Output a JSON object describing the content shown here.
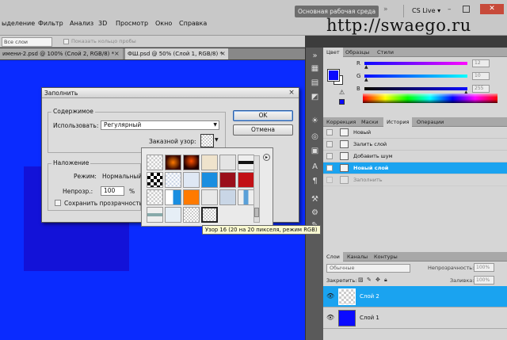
{
  "menubar": {
    "items": [
      "ыделение",
      "Фильтр",
      "Анализ",
      "3D",
      "Просмотр",
      "Окно",
      "Справка"
    ],
    "workspace_button": "Основная рабочая среда",
    "workspace_arrow": "»",
    "cslive": "CS Live ▾"
  },
  "watermark": "http://swaego.ru",
  "optbar": {
    "layer_select": "Все слои",
    "option_label": "Показать кольцо пробы"
  },
  "doctabs": [
    {
      "label": "имени-2.psd @ 100% (Слой 2, RGB/8) *"
    },
    {
      "label": "ФШ.psd @ 50% (Слой 1, RGB/8) *"
    }
  ],
  "tab_close": "×",
  "colors": {
    "foreground": "#0a0aff",
    "canvas": "#0a2bff",
    "layer_square": "#1312d8",
    "selection": "#1aa3f0"
  },
  "color_panel": {
    "tabs": [
      "Цвет",
      "Образцы",
      "Стили"
    ],
    "channels": [
      {
        "name": "R",
        "value": "12"
      },
      {
        "name": "G",
        "value": "10"
      },
      {
        "name": "B",
        "value": "255"
      }
    ]
  },
  "history_panel": {
    "tabs": [
      "Коррекция",
      "Маски",
      "История",
      "Операции"
    ],
    "items": [
      {
        "label": "Новый"
      },
      {
        "label": "Залить слой"
      },
      {
        "label": "Добавить шум"
      },
      {
        "label": "Новый слой"
      },
      {
        "label": "Заполнить"
      }
    ]
  },
  "layers_panel": {
    "tabs": [
      "Слои",
      "Каналы",
      "Контуры"
    ],
    "blend_mode": "Обычные",
    "opacity_label": "Непрозрачность:",
    "opacity_value": "100%",
    "lock_label": "Закрепить:",
    "fill_label": "Заливка:",
    "fill_value": "100%",
    "layers": [
      {
        "name": "Слой 2"
      },
      {
        "name": "Слой 1"
      }
    ]
  },
  "dialog": {
    "title": "Заполнить",
    "close": "×",
    "contents_legend": "Содержимое",
    "use_label": "Использовать:",
    "use_value": "Регулярный",
    "custom_pattern_label": "Заказной узор:",
    "blending_legend": "Наложение",
    "mode_label": "Режим:",
    "mode_value": "Нормальный",
    "opacity_label": "Непрозр.:",
    "opacity_value": "100",
    "percent": "%",
    "preserve_label": "Сохранить прозрачность",
    "ok": "OK",
    "cancel": "Отмена"
  },
  "pattern_tooltip": "Узор 16 (20 на 20 пикселя, режим RGB)",
  "popup_menu_icon": "▸"
}
